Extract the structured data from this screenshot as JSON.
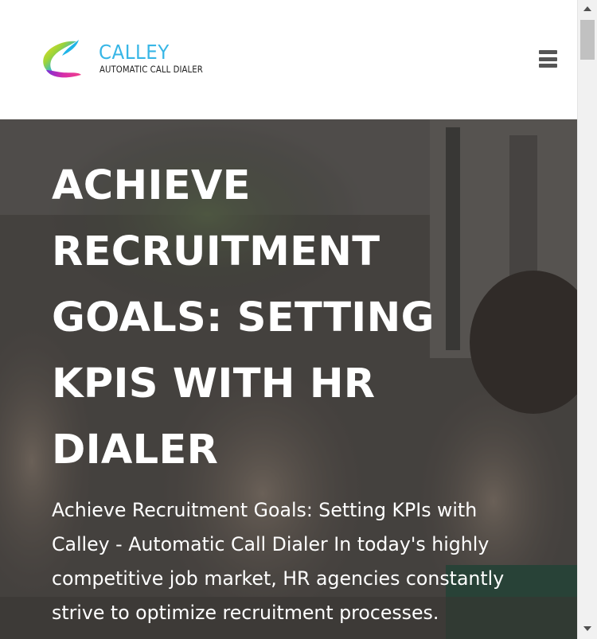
{
  "brand": {
    "name": "CALLEY",
    "tagline": "AUTOMATIC CALL DIALER",
    "logo_icon": "calley-swoosh-logo",
    "title_color": "#38b6e6"
  },
  "header": {
    "menu_icon": "hamburger-menu-icon"
  },
  "hero": {
    "title": "ACHIEVE RECRUITMENT GOALS: SETTING KPIS WITH HR DIALER",
    "description": "Achieve Recruitment Goals: Setting KPIs with Calley - Automatic Call Dialer In today's highly competitive job market, HR agencies constantly strive to optimize recruitment processes."
  }
}
